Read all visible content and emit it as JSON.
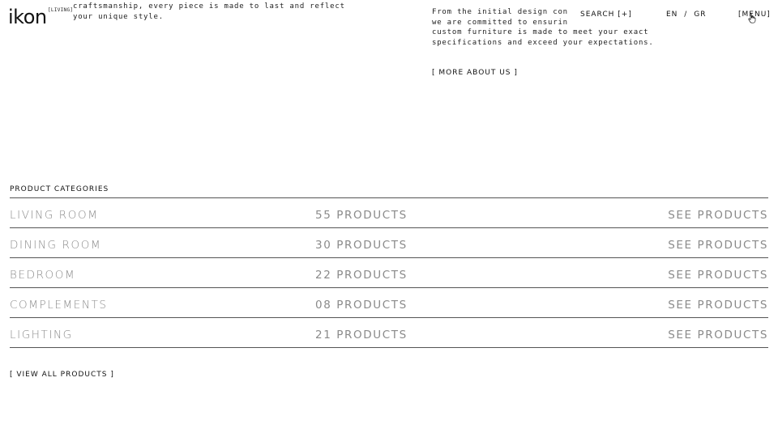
{
  "brand": {
    "logo": "ikon",
    "sub": "[LIVING]"
  },
  "intro": {
    "left_text": "craftsmanship, every piece is made to last and reflect your unique style.",
    "right_lines": [
      "From the initial design con",
      "we are committed to ensurin",
      "custom furniture is made to meet your exact",
      "specifications and exceed your expectations."
    ],
    "more_link": "[ MORE ABOUT US ]"
  },
  "nav": {
    "search": "SEARCH [+]",
    "lang_en": "EN",
    "lang_sep": "/",
    "lang_gr": "GR",
    "menu": "[MENU]"
  },
  "categories": {
    "label": "PRODUCT CATEGORIES",
    "items": [
      {
        "name": "LIVING ROOM",
        "count": "55 PRODUCTS",
        "cta": "SEE PRODUCTS"
      },
      {
        "name": "DINING ROOM",
        "count": "30 PRODUCTS",
        "cta": "SEE PRODUCTS"
      },
      {
        "name": "BEDROOM",
        "count": "22 PRODUCTS",
        "cta": "SEE PRODUCTS"
      },
      {
        "name": "COMPLEMENTS",
        "count": "08 PRODUCTS",
        "cta": "SEE PRODUCTS"
      },
      {
        "name": "LIGHTING",
        "count": "21 PRODUCTS",
        "cta": "SEE PRODUCTS"
      }
    ],
    "view_all": "[ VIEW ALL PRODUCTS ]"
  },
  "icons": {
    "cursor": "pointer-hand-icon"
  },
  "colors": {
    "text": "#1a1a1a",
    "muted": "#8a8a8a",
    "divider": "#555555",
    "background": "#ffffff"
  }
}
